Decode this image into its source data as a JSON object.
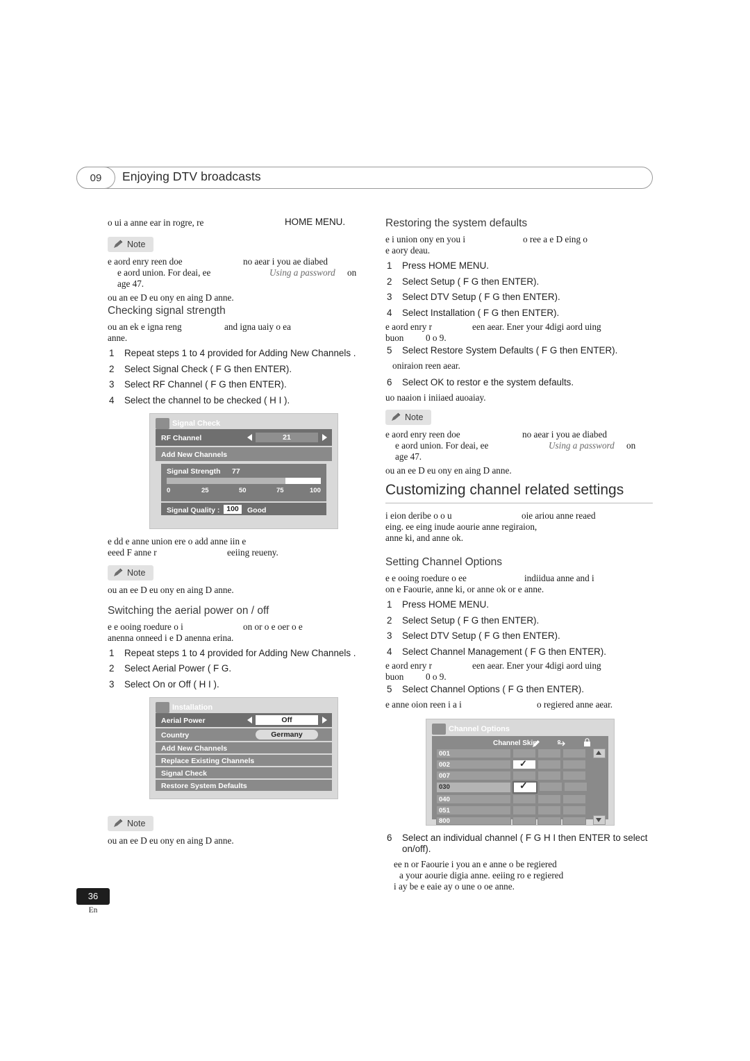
{
  "header": {
    "chapter_number": "09",
    "title": "Enjoying DTV broadcasts"
  },
  "page_footer": {
    "number": "36",
    "lang": "En"
  },
  "left_column": {
    "intro_line": "o ui a anne ear in rogre, re",
    "intro_caps": "HOME MENU.",
    "note1": {
      "label": "Note",
      "line1": "e aord enry reen doe",
      "line1b": "no aear i you ae diabed",
      "line2": "e aord union. For deai, ee",
      "line2_italic": "Using a password",
      "line2_end": "on",
      "line3": "age 47.",
      "line4": "ou an ee D eu ony en aing D anne."
    },
    "checking_signal": {
      "heading": "Checking signal strength",
      "desc1": "ou an ek e igna reng",
      "desc1b": "and igna uaiy o ea",
      "desc2": "anne.",
      "steps": [
        "Repeat steps 1 to 4 provided for  Adding New Channels .",
        "Select  Signal Check  (  F   G then ENTER).",
        "Select  RF Channel  (  F   G then ENTER).",
        "Select the channel to be checked (  H   I  )."
      ],
      "after1": "e dd e anne union ere o add anne iin e",
      "after2": "eeed F anne r",
      "after2b": "eeiing reueny.",
      "note": {
        "label": "Note",
        "body": "ou an ee D eu ony en aing D anne."
      }
    },
    "aerial_power": {
      "heading": "Switching the aerial power on / off",
      "desc1": "e e ooing roedure o i",
      "desc1b": "on or o e oer o e",
      "desc2": "anenna onneed i e D anenna erina.",
      "steps": [
        "Repeat steps 1 to 4 provided for  Adding New Channels .",
        "Select  Aerial Power  (   F   G.",
        "Select  On  or  Off  (   H   I  )."
      ],
      "note": {
        "label": "Note",
        "body": "ou an ee D eu ony en aing D anne."
      }
    },
    "signal_check_osd": {
      "title": "Signal Check",
      "rows": [
        {
          "label": "RF Channel",
          "value": "21"
        },
        {
          "label": "Add New Channels",
          "value": ""
        }
      ],
      "signal_strength_label": "Signal Strength",
      "signal_strength_value": "77",
      "scale": [
        "0",
        "25",
        "50",
        "75",
        "100"
      ],
      "signal_quality_label": "Signal Quality :",
      "signal_quality_value": "100",
      "signal_quality_text": "Good"
    },
    "installation_osd": {
      "title": "Installation",
      "rows": [
        {
          "label": "Aerial Power",
          "value": "Off"
        },
        {
          "label": "Country",
          "value": "Germany"
        },
        {
          "label": "Add New Channels",
          "value": ""
        },
        {
          "label": "Replace Existing Channels",
          "value": ""
        },
        {
          "label": "Signal Check",
          "value": ""
        },
        {
          "label": "Restore System Defaults",
          "value": ""
        }
      ]
    }
  },
  "right_column": {
    "restoring": {
      "heading": "Restoring the system defaults",
      "desc1": "e i union ony en you i",
      "desc1b": "o ree a e D eing o",
      "desc2": "e aory deau.",
      "steps": [
        "Press HOME MENU.",
        "Select  Setup  (   F   G then ENTER).",
        "Select  DTV Setup  (   F   G then ENTER).",
        "Select  Installation  (   F   G then ENTER).",
        "Select  Restore System Defaults  (   F   G then ENTER).",
        "Select  OK  to restor  e the system defaults."
      ],
      "after4a": "e aord enry r",
      "after4b": "een aear. Ener your 4digi aord uing",
      "after4c": "buon",
      "after4d": "0 o  9.",
      "after5": "oniraion reen aear.",
      "after6": "uo naaion i iniiaed auoaiay.",
      "note": {
        "label": "Note",
        "line1": "e aord enry reen doe",
        "line1b": "no aear i you ae diabed",
        "line2": "e aord union. For deai, ee",
        "line2_italic": "Using a password",
        "line2_end": "on",
        "line3": "age 47.",
        "line4": "ou an ee D eu ony en aing D anne."
      }
    },
    "customizing": {
      "heading": "Customizing channel related settings",
      "desc1": "i eion deribe o o u",
      "desc1b": "oie ariou anne reaed",
      "desc2": "eing. ee eing inude aourie anne regiraion,",
      "desc3": "anne ki, and anne ok."
    },
    "channel_options": {
      "heading": "Setting Channel Options",
      "desc1": "e e ooing roedure o ee",
      "desc1b": "indiidua anne and i",
      "desc2": "on e Faourie, anne ki, or anne ok or e anne.",
      "steps": [
        "Press HOME MENU.",
        "Select  Setup  (   F   G then ENTER).",
        "Select  DTV Setup  (   F   G then ENTER).",
        "Select  Channel Management  (   F   G then ENTER).",
        "Select  Channel Options  (   F   G then ENTER)."
      ],
      "after4a": "e aord enry r",
      "after4b": "een aear. Ener your 4digi aord uing",
      "after4c": "buon",
      "after4d": "0 o  9.",
      "after5": "e anne oion reen i a i",
      "after5b": "o regiered anne aear.",
      "step6": "Select an individual channel (   F   G   H   I then ENTER to select on/off).",
      "after6a": "ee n or Faourie i you an e anne o be regiered",
      "after6b": "a your aourie digia anne. eeiing ro e regiered",
      "after6c": "i ay be e eaie ay o une o oe anne."
    },
    "channel_options_osd": {
      "title": "Channel Options",
      "column_header": "Channel Skip",
      "icons": [
        "pencil-icon",
        "skip-icon",
        "lock-icon"
      ],
      "rows": [
        "001",
        "002",
        "007",
        "030",
        "040",
        "051",
        "800"
      ],
      "checked_rows": [
        "002",
        "030"
      ]
    }
  }
}
